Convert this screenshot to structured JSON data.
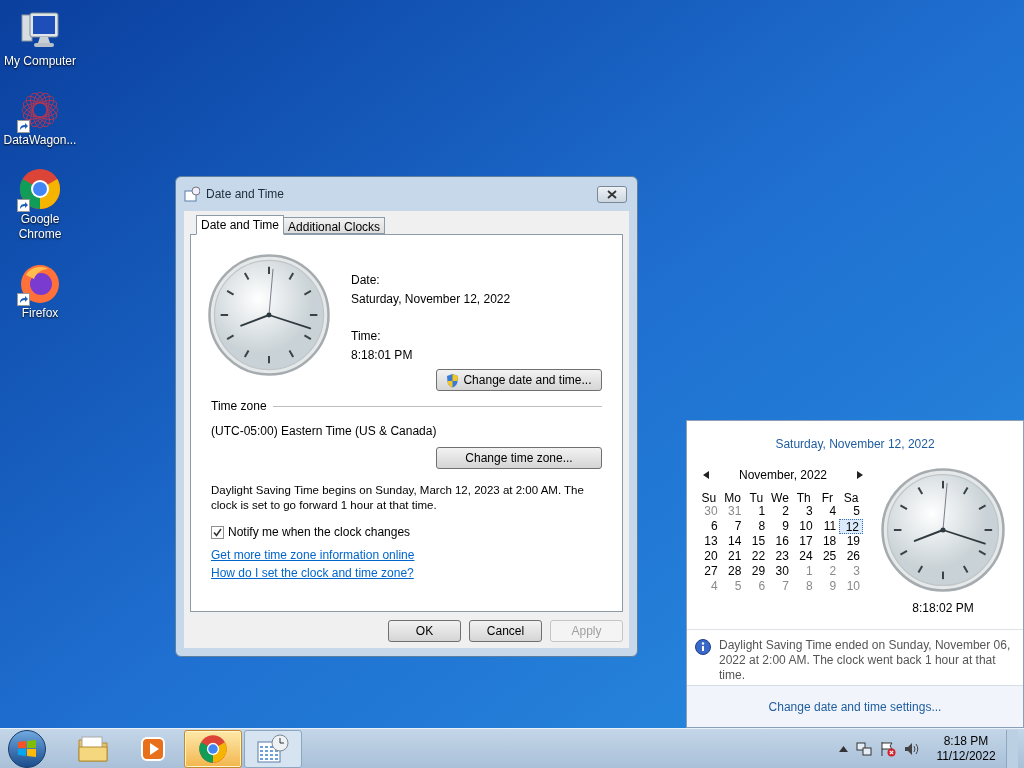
{
  "desktop_icons": [
    {
      "label": "My Computer",
      "kind": "computer",
      "shortcut": false
    },
    {
      "label": "DataWagon...",
      "kind": "network",
      "shortcut": true
    },
    {
      "label": "Google Chrome",
      "kind": "chrome",
      "shortcut": true
    },
    {
      "label": "Firefox",
      "kind": "firefox",
      "shortcut": true
    }
  ],
  "dialog": {
    "title": "Date and Time",
    "tabs": [
      {
        "label": "Date and Time",
        "selected": true
      },
      {
        "label": "Additional Clocks",
        "selected": false
      }
    ],
    "date_label": "Date:",
    "date_value": "Saturday, November 12, 2022",
    "time_label": "Time:",
    "time_value": "8:18:01 PM",
    "change_date_button": "Change date and time...",
    "time_zone_heading": "Time zone",
    "time_zone_value": "(UTC-05:00) Eastern Time (US & Canada)",
    "change_zone_button": "Change time zone...",
    "dst_note": "Daylight Saving Time begins on Sunday, March 12, 2023 at 2:00 AM. The clock is set to go forward 1 hour at that time.",
    "notify": {
      "label": "Notify me when the clock changes",
      "checked": true
    },
    "links": [
      "Get more time zone information online",
      "How do I set the clock and time zone?"
    ],
    "buttons": [
      {
        "label": "OK",
        "disabled": false
      },
      {
        "label": "Cancel",
        "disabled": false
      },
      {
        "label": "Apply",
        "disabled": true
      }
    ]
  },
  "popup": {
    "date_heading": "Saturday, November 12, 2022",
    "month_title": "November, 2022",
    "weekdays": [
      "Su",
      "Mo",
      "Tu",
      "We",
      "Th",
      "Fr",
      "Sa"
    ],
    "days": [
      {
        "label": "30",
        "other_month": true,
        "selected": false
      },
      {
        "label": "31",
        "other_month": true,
        "selected": false
      },
      {
        "label": "1",
        "other_month": false,
        "selected": false
      },
      {
        "label": "2",
        "other_month": false,
        "selected": false
      },
      {
        "label": "3",
        "other_month": false,
        "selected": false
      },
      {
        "label": "4",
        "other_month": false,
        "selected": false
      },
      {
        "label": "5",
        "other_month": false,
        "selected": false
      },
      {
        "label": "6",
        "other_month": false,
        "selected": false
      },
      {
        "label": "7",
        "other_month": false,
        "selected": false
      },
      {
        "label": "8",
        "other_month": false,
        "selected": false
      },
      {
        "label": "9",
        "other_month": false,
        "selected": false
      },
      {
        "label": "10",
        "other_month": false,
        "selected": false
      },
      {
        "label": "11",
        "other_month": false,
        "selected": false
      },
      {
        "label": "12",
        "other_month": false,
        "selected": true
      },
      {
        "label": "13",
        "other_month": false,
        "selected": false
      },
      {
        "label": "14",
        "other_month": false,
        "selected": false
      },
      {
        "label": "15",
        "other_month": false,
        "selected": false
      },
      {
        "label": "16",
        "other_month": false,
        "selected": false
      },
      {
        "label": "17",
        "other_month": false,
        "selected": false
      },
      {
        "label": "18",
        "other_month": false,
        "selected": false
      },
      {
        "label": "19",
        "other_month": false,
        "selected": false
      },
      {
        "label": "20",
        "other_month": false,
        "selected": false
      },
      {
        "label": "21",
        "other_month": false,
        "selected": false
      },
      {
        "label": "22",
        "other_month": false,
        "selected": false
      },
      {
        "label": "23",
        "other_month": false,
        "selected": false
      },
      {
        "label": "24",
        "other_month": false,
        "selected": false
      },
      {
        "label": "25",
        "other_month": false,
        "selected": false
      },
      {
        "label": "26",
        "other_month": false,
        "selected": false
      },
      {
        "label": "27",
        "other_month": false,
        "selected": false
      },
      {
        "label": "28",
        "other_month": false,
        "selected": false
      },
      {
        "label": "29",
        "other_month": false,
        "selected": false
      },
      {
        "label": "30",
        "other_month": false,
        "selected": false
      },
      {
        "label": "1",
        "other_month": true,
        "selected": false
      },
      {
        "label": "2",
        "other_month": true,
        "selected": false
      },
      {
        "label": "3",
        "other_month": true,
        "selected": false
      },
      {
        "label": "4",
        "other_month": true,
        "selected": false
      },
      {
        "label": "5",
        "other_month": true,
        "selected": false
      },
      {
        "label": "6",
        "other_month": true,
        "selected": false
      },
      {
        "label": "7",
        "other_month": true,
        "selected": false
      },
      {
        "label": "8",
        "other_month": true,
        "selected": false
      },
      {
        "label": "9",
        "other_month": true,
        "selected": false
      },
      {
        "label": "10",
        "other_month": true,
        "selected": false
      }
    ],
    "time": "8:18:02 PM",
    "info_text": "Daylight Saving Time ended on Sunday, November 06, 2022 at 2:00 AM. The clock went back 1 hour at that time.",
    "settings_link": "Change date and time settings..."
  },
  "taskbar": {
    "apps": [
      {
        "kind": "explorer",
        "hovered": false,
        "running": false
      },
      {
        "kind": "media",
        "hovered": false,
        "running": false
      },
      {
        "kind": "chrome",
        "hovered": true,
        "running": true
      },
      {
        "kind": "calendar",
        "hovered": false,
        "running": true
      }
    ],
    "clock_time": "8:18 PM",
    "clock_date": "11/12/2022"
  }
}
